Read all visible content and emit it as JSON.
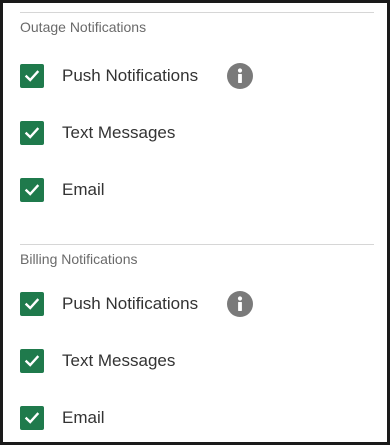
{
  "colors": {
    "checkbox_fill": "#1f7a4c",
    "info_icon": "#7a7a7a",
    "section_title": "#6a6a6a",
    "label_text": "#333333"
  },
  "sections": [
    {
      "title": "Outage Notifications",
      "options": [
        {
          "label": "Push Notifications",
          "checked": true,
          "has_info_icon": true
        },
        {
          "label": "Text Messages",
          "checked": true,
          "has_info_icon": false
        },
        {
          "label": "Email",
          "checked": true,
          "has_info_icon": false
        }
      ]
    },
    {
      "title": "Billing Notifications",
      "options": [
        {
          "label": "Push Notifications",
          "checked": true,
          "has_info_icon": true
        },
        {
          "label": "Text Messages",
          "checked": true,
          "has_info_icon": false
        },
        {
          "label": "Email",
          "checked": true,
          "has_info_icon": false
        }
      ]
    }
  ]
}
